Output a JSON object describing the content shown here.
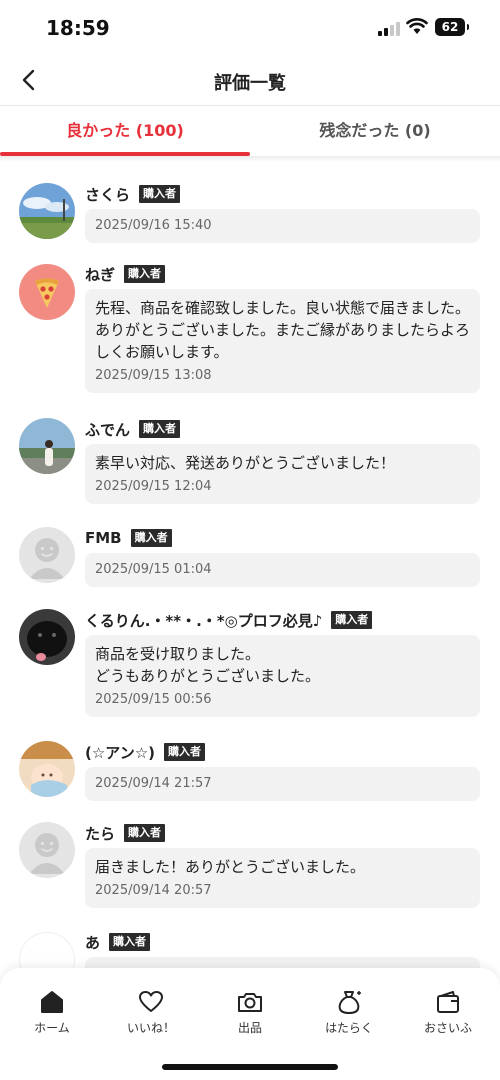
{
  "status": {
    "time": "18:59",
    "battery": "62"
  },
  "header": {
    "title": "評価一覧",
    "back_icon": "chevron-left-icon"
  },
  "tabs": [
    {
      "label": "良かった (100)",
      "active": true
    },
    {
      "label": "残念だった (0)",
      "active": false
    }
  ],
  "badge_label": "購入者",
  "reviews": [
    {
      "name": "さくら",
      "comment": "",
      "date": "2025/09/16 15:40",
      "avatar": "landscape-photo"
    },
    {
      "name": "ねぎ",
      "comment": "先程、商品を確認致しました。良い状態で届きました。ありがとうございました。またご縁がありましたらよろしくお願いします。",
      "date": "2025/09/15 13:08",
      "avatar": "pizza-icon"
    },
    {
      "name": "ふでん",
      "comment": "素早い対応、発送ありがとうございました！",
      "date": "2025/09/15 12:04",
      "avatar": "person-photo"
    },
    {
      "name": "FMB",
      "comment": "",
      "date": "2025/09/15 01:04",
      "avatar": "default-user-icon"
    },
    {
      "name": "くるりん.・**・.・*◎プロフ必見♪",
      "comment": "商品を受け取りました。\nどうもありがとうございました。",
      "date": "2025/09/15 00:56",
      "avatar": "black-dog-photo"
    },
    {
      "name": "(☆アン☆)",
      "comment": "",
      "date": "2025/09/14 21:57",
      "avatar": "baby-photo"
    },
    {
      "name": "たら",
      "comment": "届きました！ありがとうございました。",
      "date": "2025/09/14 20:57",
      "avatar": "default-user-icon"
    },
    {
      "name": "あ",
      "comment": "",
      "date": "",
      "avatar": "blank-avatar"
    }
  ],
  "bottom_nav": [
    {
      "label": "ホーム",
      "icon": "home-icon"
    },
    {
      "label": "いいね！",
      "icon": "heart-icon"
    },
    {
      "label": "出品",
      "icon": "camera-icon"
    },
    {
      "label": "はたらく",
      "icon": "money-bag-icon"
    },
    {
      "label": "おさいふ",
      "icon": "wallet-icon"
    }
  ],
  "colors": {
    "accent": "#e8303a",
    "badge": "#2b2b2b",
    "bubble": "#f2f2f2"
  }
}
